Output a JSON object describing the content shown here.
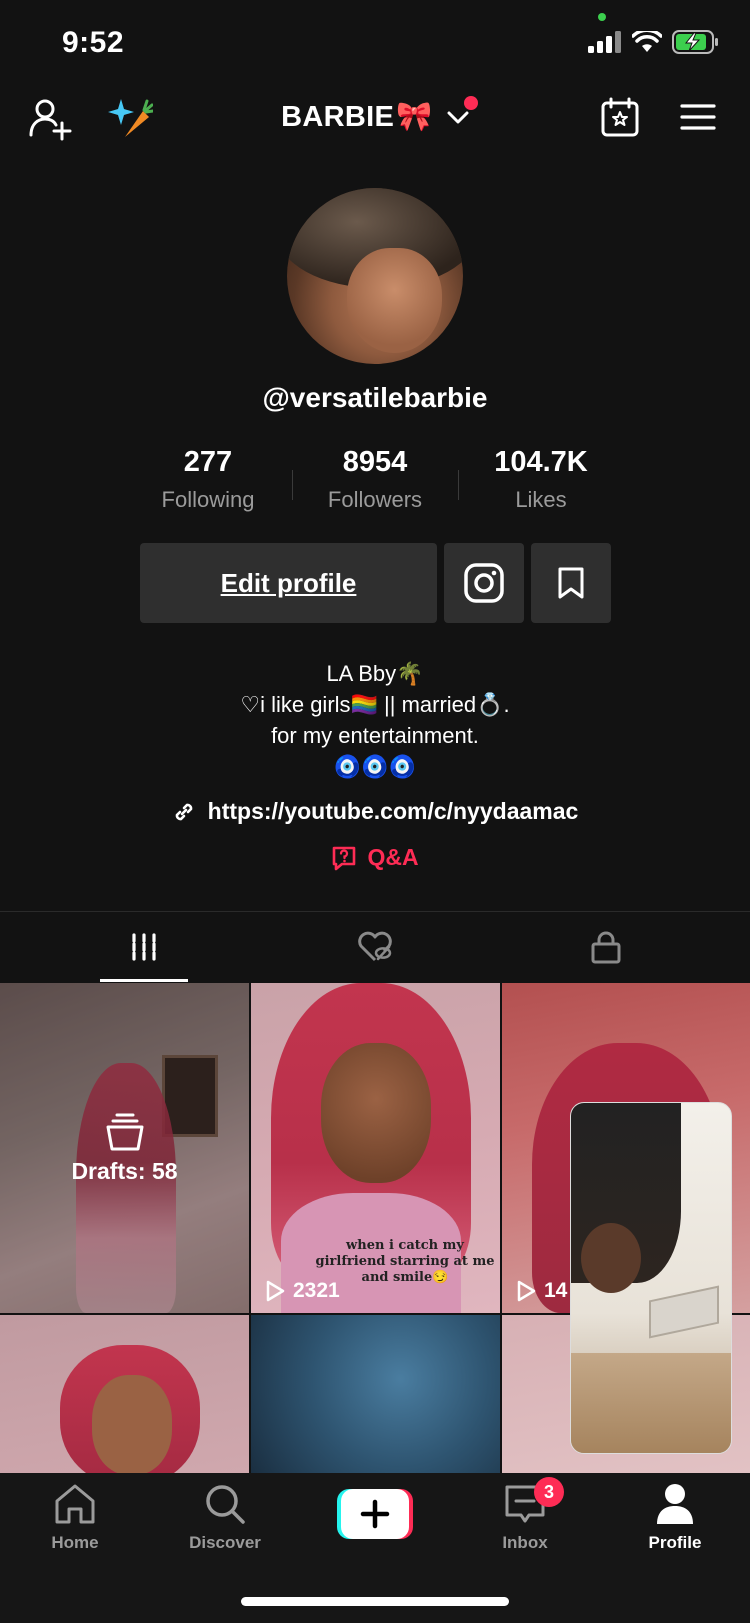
{
  "status_bar": {
    "time": "9:52"
  },
  "header": {
    "title": "BARBIE",
    "title_emoji": "🎀"
  },
  "profile": {
    "handle": "@versatilebarbie",
    "stats": [
      {
        "value": "277",
        "label": "Following"
      },
      {
        "value": "8954",
        "label": "Followers"
      },
      {
        "value": "104.7K",
        "label": "Likes"
      }
    ],
    "edit_label": "Edit profile",
    "bio_lines": [
      "LA Bby🌴",
      "♡i like girls🏳️‍🌈 || married💍.",
      "for my entertainment.",
      "🧿🧿🧿"
    ],
    "link": "https://youtube.com/c/nyydaamac",
    "qa_label": "Q&A"
  },
  "grid": {
    "drafts_label": "Drafts: 58",
    "tiles": [
      {
        "play_count": ""
      },
      {
        "play_count": "2321",
        "caption": "when i catch my girlfriend starring at me and smile😏"
      },
      {
        "play_count": "14"
      }
    ]
  },
  "nav": {
    "items": [
      {
        "label": "Home",
        "icon": "home-icon"
      },
      {
        "label": "Discover",
        "icon": "search-icon"
      },
      {
        "label": "",
        "icon": "plus-icon"
      },
      {
        "label": "Inbox",
        "icon": "inbox-icon",
        "badge": "3"
      },
      {
        "label": "Profile",
        "icon": "profile-icon"
      }
    ]
  },
  "colors": {
    "accent": "#fe2c55",
    "background": "#121212",
    "button": "#2f2f2f"
  }
}
